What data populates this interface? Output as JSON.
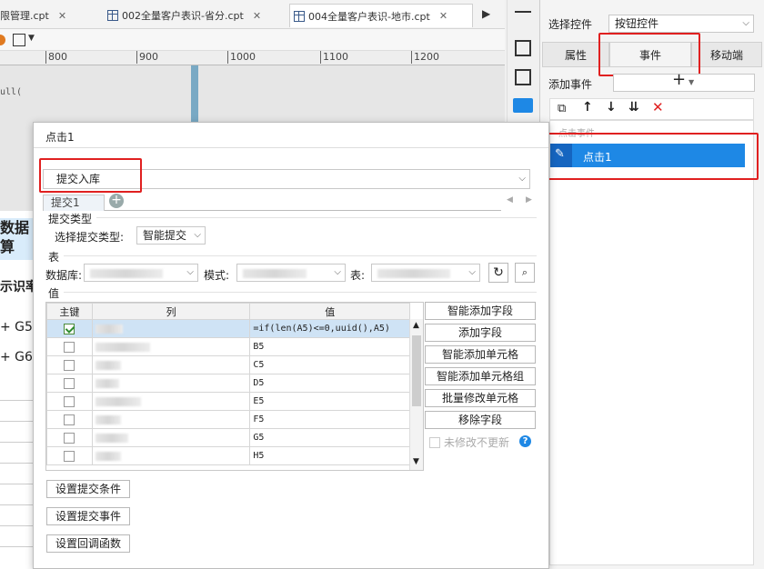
{
  "tabs": [
    {
      "label": "限管理.cpt",
      "active": false
    },
    {
      "label": "002全量客户表识-省分.cpt",
      "active": false
    },
    {
      "label": "004全量客户表识-地市.cpt",
      "active": true
    }
  ],
  "ruler": [
    "800",
    "900",
    "1000",
    "1100",
    "1200"
  ],
  "canvas": {
    "code_text": "ull(",
    "cell_header_1": "数据",
    "cell_header_2": "算",
    "cell_text_3": "示识率",
    "row_g5": "+ G5",
    "row_g6": "+ G6"
  },
  "right_panel": {
    "select_control_label": "选择控件",
    "select_control_value": "按钮控件",
    "tabs": [
      "属性",
      "事件",
      "移动端"
    ],
    "add_event_label": "添加事件",
    "event_group_label": "点击事件",
    "event_item": "点击1"
  },
  "dialog": {
    "title": "点击1",
    "action_select": "提交入库",
    "sub_tab": "提交1",
    "submit_type_section": "提交类型",
    "submit_type_label": "选择提交类型:",
    "submit_type_value": "智能提交",
    "table_section": "表",
    "db_label": "数据库:",
    "schema_label": "模式:",
    "table_label": "表:",
    "value_section": "值",
    "grid_headers": [
      "主键",
      "列",
      "值"
    ],
    "rows": [
      {
        "checked": true,
        "value": "=if(len(A5)<=0,uuid(),A5)"
      },
      {
        "checked": false,
        "value": "B5"
      },
      {
        "checked": false,
        "value": "C5"
      },
      {
        "checked": false,
        "value": "D5"
      },
      {
        "checked": false,
        "value": "E5"
      },
      {
        "checked": false,
        "value": "F5"
      },
      {
        "checked": false,
        "value": "G5"
      },
      {
        "checked": false,
        "value": "H5"
      }
    ],
    "side_buttons": [
      "智能添加字段",
      "添加字段",
      "智能添加单元格",
      "智能添加单元格组",
      "批量修改单元格",
      "移除字段"
    ],
    "unmodified_label": "未修改不更新",
    "bottom_buttons": [
      "设置提交条件",
      "设置提交事件",
      "设置回调函数"
    ]
  },
  "colors": {
    "accent": "#1e88e5",
    "highlight_box": "#e02020",
    "selected_row": "#cfe3f5"
  }
}
